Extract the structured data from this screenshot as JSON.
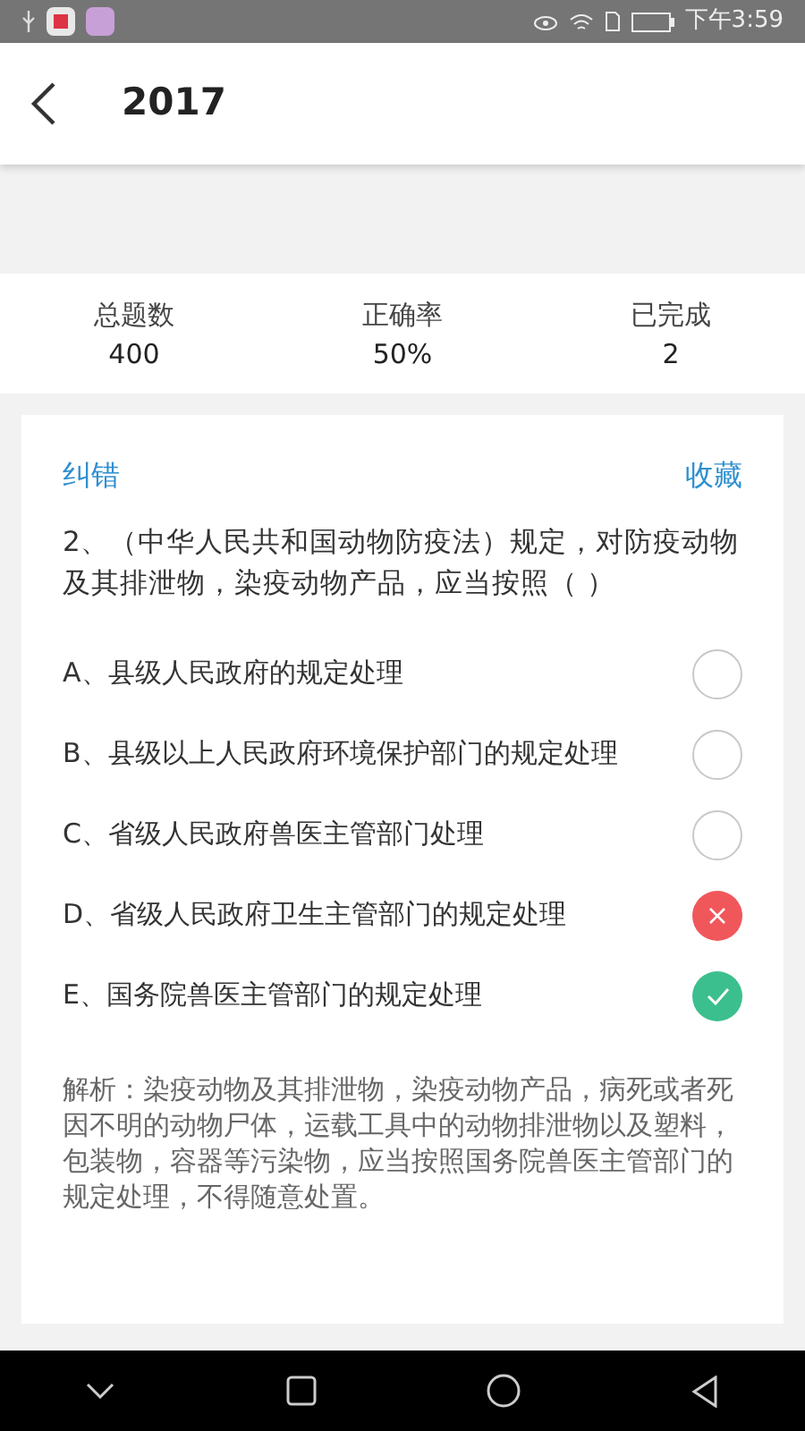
{
  "status_bar": {
    "time": "下午3:59"
  },
  "header": {
    "title": "2017"
  },
  "stats": [
    {
      "label": "总题数",
      "value": "400"
    },
    {
      "label": "正确率",
      "value": "50%"
    },
    {
      "label": "已完成",
      "value": "2"
    }
  ],
  "card": {
    "report_link": "纠错",
    "favorite_link": "收藏",
    "question": "2、（中华人民共和国动物防疫法）规定，对防疫动物及其排泄物，染疫动物产品，应当按照（ ）",
    "options": [
      {
        "text": "A、县级人民政府的规定处理",
        "kind": "empty"
      },
      {
        "text": "B、县级以上人民政府环境保护部门的规定处理",
        "kind": "empty"
      },
      {
        "text": "C、省级人民政府兽医主管部门处理",
        "kind": "empty"
      },
      {
        "text": "D、省级人民政府卫生主管部门的规定处理",
        "kind": "wrong"
      },
      {
        "text": "E、国务院兽医主管部门的规定处理",
        "kind": "correct"
      }
    ],
    "explanation": "解析：染疫动物及其排泄物，染疫动物产品，病死或者死因不明的动物尸体，运载工具中的动物排泄物以及塑料，包装物，容器等污染物，应当按照国务院兽医主管部门的规定处理，不得随意处置。"
  }
}
